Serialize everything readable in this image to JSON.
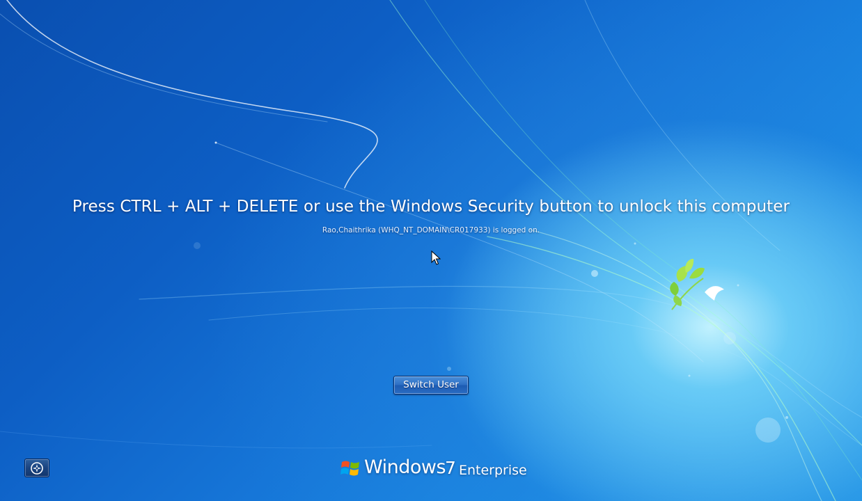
{
  "lock_screen": {
    "message": "Press CTRL + ALT + DELETE or use the Windows Security button to unlock this computer",
    "logged_on_text": "Rao,Chaithrika (WHQ_NT_DOMAIN\\CR017933) is logged on.",
    "switch_user_label": "Switch User"
  },
  "branding": {
    "product": "Windows",
    "version": "7",
    "edition": "Enterprise"
  },
  "icons": {
    "ease_of_access": "ease-of-access-icon",
    "windows_logo": "windows-flag-icon",
    "pointer": "mouse-pointer-icon"
  },
  "colors": {
    "background_dark": "#0a4fb0",
    "background_light": "#2ea8ee",
    "glow": "#c8f5ff",
    "accent_green": "#9be24a"
  }
}
